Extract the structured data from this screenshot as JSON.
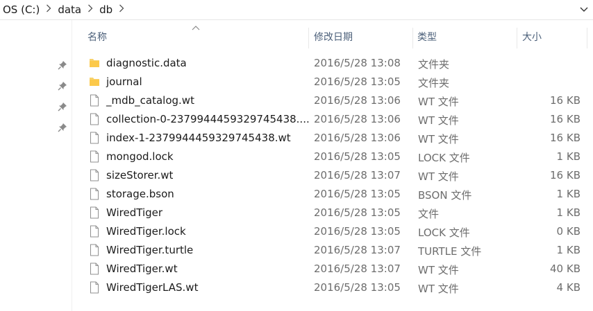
{
  "breadcrumb": {
    "items": [
      "OS (C:)",
      "data",
      "db"
    ]
  },
  "columns": {
    "name": "名称",
    "date": "修改日期",
    "type": "类型",
    "size": "大小"
  },
  "files": [
    {
      "name": "diagnostic.data",
      "date": "2016/5/28 13:08",
      "type": "文件夹",
      "size": "",
      "icon": "folder-icon"
    },
    {
      "name": "journal",
      "date": "2016/5/28 13:05",
      "type": "文件夹",
      "size": "",
      "icon": "folder-icon"
    },
    {
      "name": "_mdb_catalog.wt",
      "date": "2016/5/28 13:06",
      "type": "WT 文件",
      "size": "16 KB",
      "icon": "file-icon"
    },
    {
      "name": "collection-0-2379944459329745438....",
      "date": "2016/5/28 13:06",
      "type": "WT 文件",
      "size": "16 KB",
      "icon": "file-icon"
    },
    {
      "name": "index-1-2379944459329745438.wt",
      "date": "2016/5/28 13:06",
      "type": "WT 文件",
      "size": "16 KB",
      "icon": "file-icon"
    },
    {
      "name": "mongod.lock",
      "date": "2016/5/28 13:05",
      "type": "LOCK 文件",
      "size": "1 KB",
      "icon": "file-icon"
    },
    {
      "name": "sizeStorer.wt",
      "date": "2016/5/28 13:07",
      "type": "WT 文件",
      "size": "16 KB",
      "icon": "file-icon"
    },
    {
      "name": "storage.bson",
      "date": "2016/5/28 13:05",
      "type": "BSON 文件",
      "size": "1 KB",
      "icon": "file-icon"
    },
    {
      "name": "WiredTiger",
      "date": "2016/5/28 13:05",
      "type": "文件",
      "size": "1 KB",
      "icon": "file-icon"
    },
    {
      "name": "WiredTiger.lock",
      "date": "2016/5/28 13:05",
      "type": "LOCK 文件",
      "size": "0 KB",
      "icon": "file-icon"
    },
    {
      "name": "WiredTiger.turtle",
      "date": "2016/5/28 13:07",
      "type": "TURTLE 文件",
      "size": "1 KB",
      "icon": "file-icon"
    },
    {
      "name": "WiredTiger.wt",
      "date": "2016/5/28 13:07",
      "type": "WT 文件",
      "size": "40 KB",
      "icon": "file-icon"
    },
    {
      "name": "WiredTigerLAS.wt",
      "date": "2016/5/28 13:05",
      "type": "WT 文件",
      "size": "4 KB",
      "icon": "file-icon"
    }
  ],
  "colors": {
    "folder": "#f8d26b",
    "header_text": "#4c607a",
    "meta_text": "#6d6d6d"
  }
}
